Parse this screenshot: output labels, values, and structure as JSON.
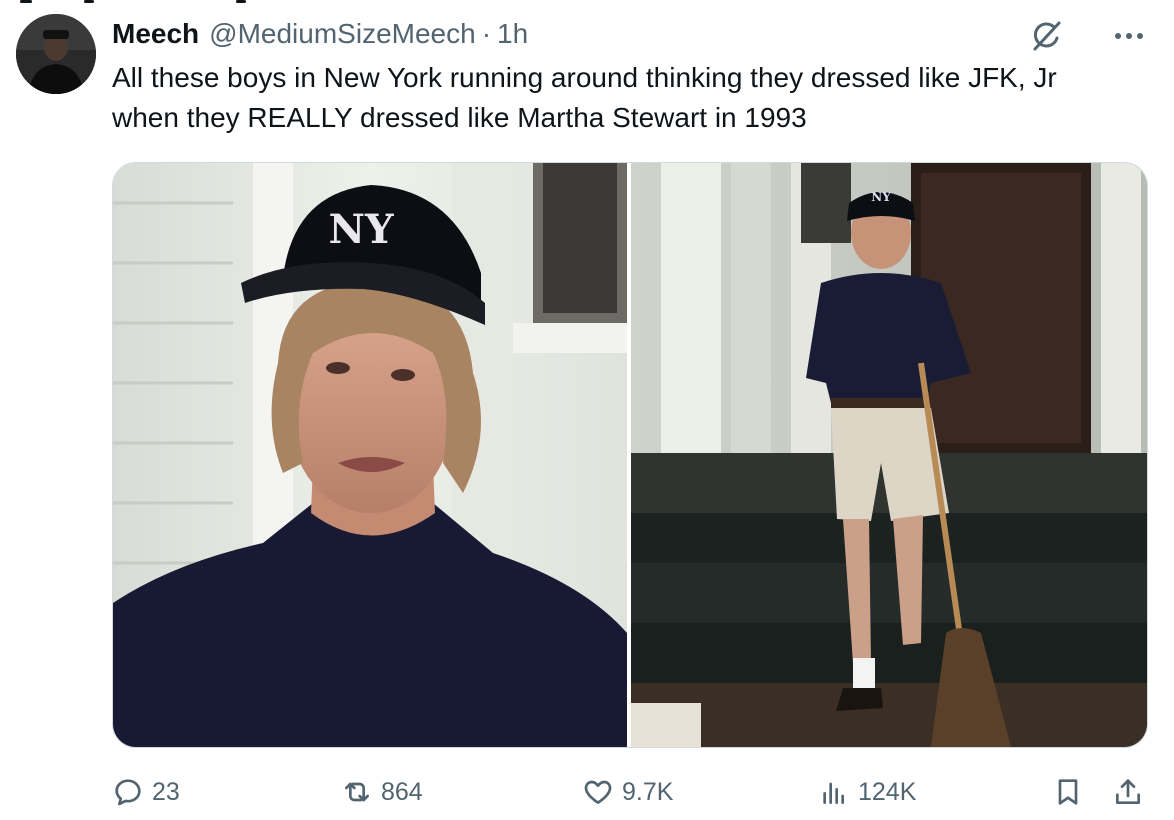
{
  "tweet": {
    "author_name": "Meech",
    "author_handle": "@MediumSizeMeech",
    "separator": "·",
    "time": "1h",
    "text_lines": [
      "All these boys in New York running around thinking they dressed like JFK, Jr",
      "when they REALLY dressed like Martha Stewart in 1993"
    ],
    "media": [
      {
        "name": "photo-closeup",
        "cap_logo": "NY"
      },
      {
        "name": "photo-porch",
        "cap_logo": "NY"
      }
    ],
    "stats": {
      "replies": "23",
      "reposts": "864",
      "likes": "9.7K",
      "views": "124K"
    }
  },
  "icons": {
    "reply": "reply-icon",
    "repost": "repost-icon",
    "like": "heart-icon",
    "views": "views-icon",
    "bookmark": "bookmark-icon",
    "share": "share-icon",
    "grok": "grok-icon",
    "more": "more-icon"
  },
  "colors": {
    "text": "#0f1419",
    "secondary": "#536471",
    "border": "#cfd9de"
  }
}
